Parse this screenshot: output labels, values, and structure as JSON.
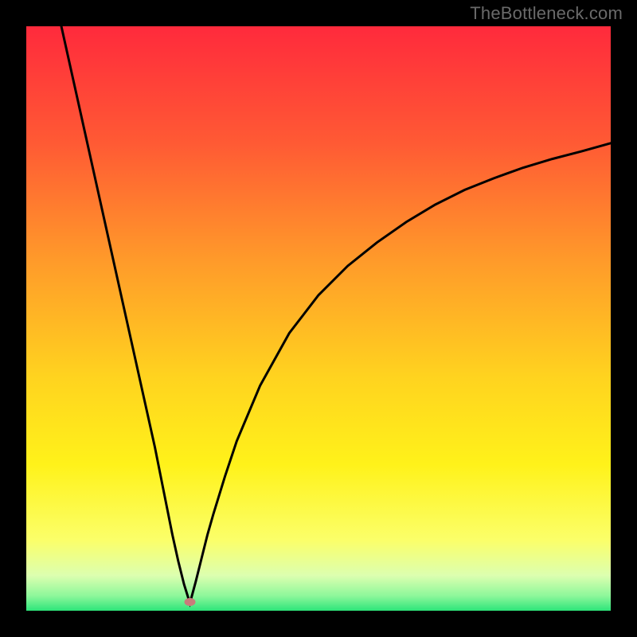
{
  "watermark": "TheBottleneck.com",
  "chart_data": {
    "type": "line",
    "title": "",
    "xlabel": "",
    "ylabel": "",
    "xlim": [
      0,
      100
    ],
    "ylim": [
      0,
      100
    ],
    "x_min_at": 28,
    "gradient_stops": [
      {
        "offset": 0.0,
        "color": "#ff2a3c"
      },
      {
        "offset": 0.2,
        "color": "#ff5a34"
      },
      {
        "offset": 0.4,
        "color": "#ff9a2a"
      },
      {
        "offset": 0.6,
        "color": "#ffd31f"
      },
      {
        "offset": 0.75,
        "color": "#fff21a"
      },
      {
        "offset": 0.88,
        "color": "#fbff6a"
      },
      {
        "offset": 0.94,
        "color": "#dcffb0"
      },
      {
        "offset": 0.975,
        "color": "#8cf79a"
      },
      {
        "offset": 1.0,
        "color": "#2de57a"
      }
    ],
    "marker": {
      "x": 28,
      "y": 1.5,
      "color": "#c97b7b"
    },
    "series": [
      {
        "name": "left",
        "x": [
          6,
          8,
          10,
          12,
          14,
          16,
          18,
          20,
          22,
          24,
          25,
          26,
          27,
          28
        ],
        "y": [
          100,
          91,
          82,
          73,
          64,
          55,
          46,
          37,
          28,
          18,
          13,
          8.5,
          4.5,
          1.3
        ]
      },
      {
        "name": "right",
        "x": [
          28,
          29,
          30,
          31,
          32,
          34,
          36,
          40,
          45,
          50,
          55,
          60,
          65,
          70,
          75,
          80,
          85,
          90,
          95,
          100
        ],
        "y": [
          1.3,
          5,
          9,
          13,
          16.5,
          23,
          29,
          38.5,
          47.5,
          54,
          59,
          63,
          66.5,
          69.5,
          72,
          74,
          75.8,
          77.3,
          78.6,
          80
        ]
      }
    ]
  }
}
